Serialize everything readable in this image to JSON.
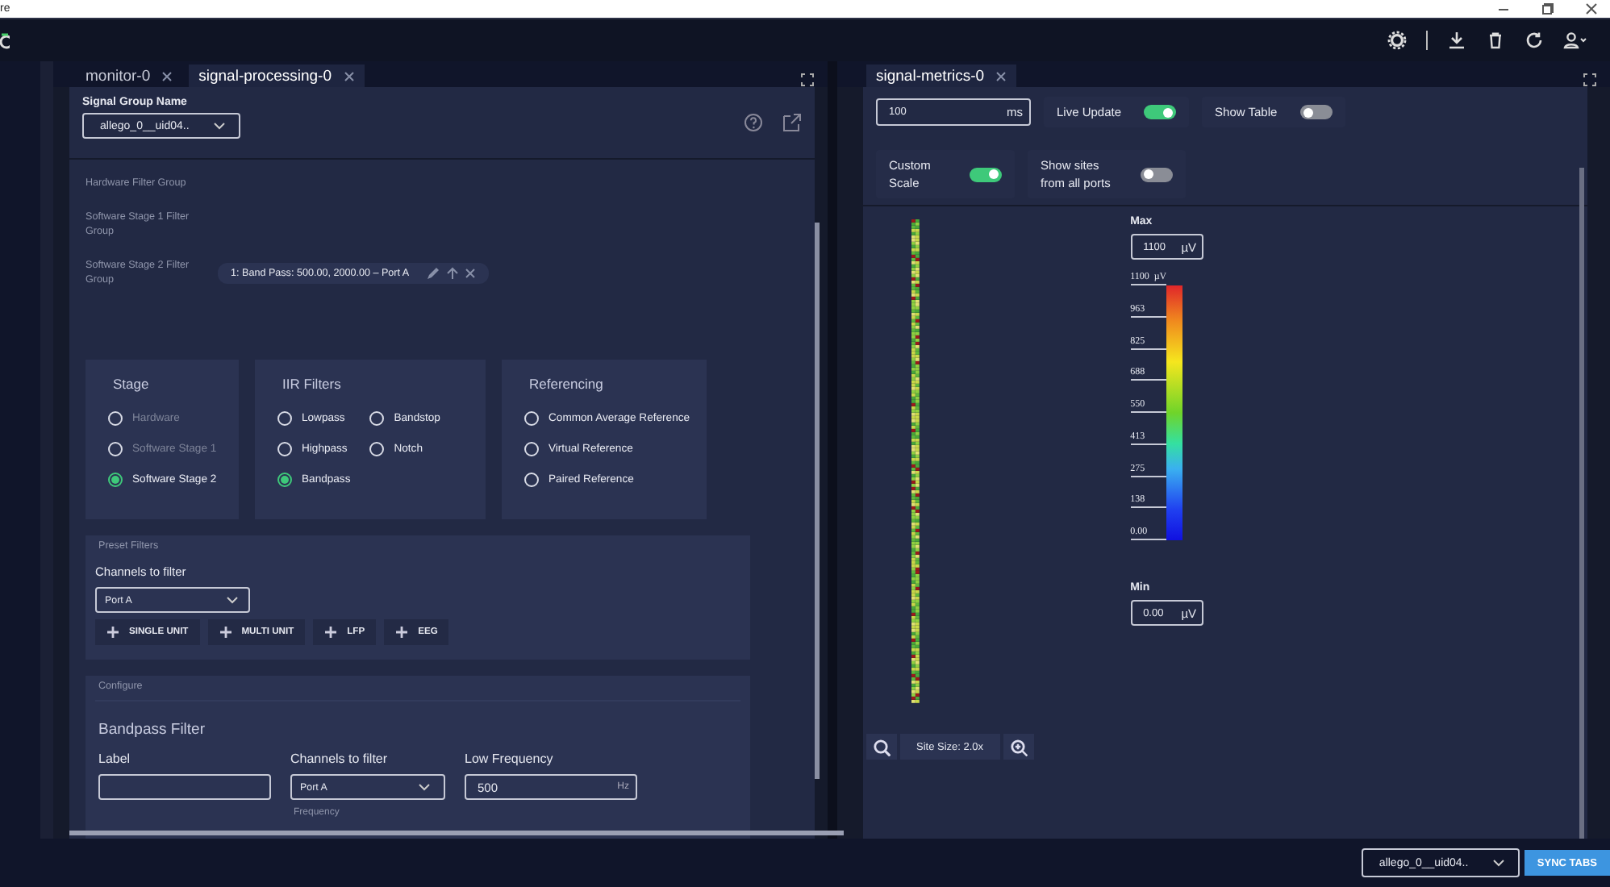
{
  "window": {
    "title": "re"
  },
  "left_pane": {
    "tabs": [
      {
        "label": "monitor-0",
        "selected": false
      },
      {
        "label": "signal-processing-0",
        "selected": true
      }
    ],
    "signal_group": {
      "label": "Signal Group Name",
      "value": "allego_0__uid04.."
    },
    "filter_groups": [
      {
        "label": "Hardware Filter Group"
      },
      {
        "label": "Software Stage 1 Filter Group"
      },
      {
        "label": "Software Stage 2 Filter Group",
        "chips": [
          "1: Band Pass: 500.00, 2000.00 – Port A"
        ]
      }
    ],
    "radio_cards": [
      {
        "title": "Stage",
        "options": [
          {
            "label": "Hardware",
            "selected": false,
            "disabled": true
          },
          {
            "label": "Software Stage 1",
            "selected": false,
            "disabled": true
          },
          {
            "label": "Software Stage 2",
            "selected": true,
            "disabled": false
          }
        ]
      },
      {
        "title": "IIR Filters",
        "options": [
          {
            "label": "Lowpass",
            "selected": false,
            "disabled": false
          },
          {
            "label": "Bandstop",
            "selected": false,
            "disabled": false
          },
          {
            "label": "Highpass",
            "selected": false,
            "disabled": false
          },
          {
            "label": "Notch",
            "selected": false,
            "disabled": false
          },
          {
            "label": "Bandpass",
            "selected": true,
            "disabled": false
          }
        ]
      },
      {
        "title": "Referencing",
        "options": [
          {
            "label": "Common Average Reference",
            "selected": false,
            "disabled": false
          },
          {
            "label": "Virtual Reference",
            "selected": false,
            "disabled": false
          },
          {
            "label": "Paired Reference",
            "selected": false,
            "disabled": false
          }
        ]
      }
    ],
    "preset_filters": {
      "title": "Preset Filters",
      "channels_label": "Channels to filter",
      "channels_value": "Port A",
      "buttons": [
        "SINGLE UNIT",
        "MULTI UNIT",
        "LFP",
        "EEG"
      ]
    },
    "configure": {
      "title": "Configure",
      "heading": "Bandpass Filter",
      "fields": [
        {
          "kind": "text",
          "label": "Label"
        },
        {
          "kind": "select",
          "label": "Channels to filter",
          "value": "Port A",
          "hint": "Frequency"
        },
        {
          "kind": "number",
          "label": "Low Frequency",
          "value": "500",
          "unit": "Hz"
        }
      ]
    }
  },
  "right_pane": {
    "tabs": [
      {
        "label": "signal-metrics-0",
        "selected": true
      }
    ],
    "lookback": {
      "value": "100",
      "unit": "ms"
    },
    "toggles": [
      {
        "label": "Live Update",
        "on": true
      },
      {
        "label": "Show Table",
        "on": false
      },
      {
        "label": "Custom Scale",
        "on": true
      },
      {
        "label": "Show sites from all ports",
        "on": false
      }
    ],
    "max": {
      "label": "Max",
      "value": "1100",
      "unit": "µV"
    },
    "scale_ticks": [
      "1100  µV",
      "963",
      "825",
      "688",
      "550",
      "413",
      "275",
      "138",
      "0.00"
    ],
    "min": {
      "label": "Min",
      "value": "0.00",
      "unit": "µV"
    },
    "site_size": "Site Size: 2.0x"
  },
  "footer": {
    "group_value": "allego_0__uid04..",
    "sync_button": "SYNC TABS"
  }
}
